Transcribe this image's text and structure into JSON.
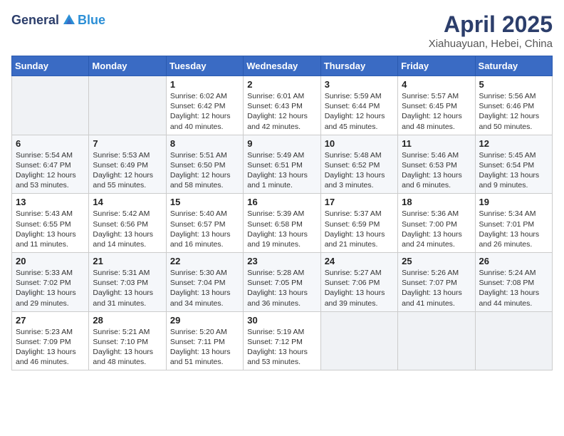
{
  "header": {
    "logo_general": "General",
    "logo_blue": "Blue",
    "title": "April 2025",
    "subtitle": "Xiahuayuan, Hebei, China"
  },
  "weekdays": [
    "Sunday",
    "Monday",
    "Tuesday",
    "Wednesday",
    "Thursday",
    "Friday",
    "Saturday"
  ],
  "weeks": [
    [
      {
        "day": "",
        "empty": true
      },
      {
        "day": "",
        "empty": true
      },
      {
        "day": "1",
        "sunrise": "Sunrise: 6:02 AM",
        "sunset": "Sunset: 6:42 PM",
        "daylight": "Daylight: 12 hours and 40 minutes."
      },
      {
        "day": "2",
        "sunrise": "Sunrise: 6:01 AM",
        "sunset": "Sunset: 6:43 PM",
        "daylight": "Daylight: 12 hours and 42 minutes."
      },
      {
        "day": "3",
        "sunrise": "Sunrise: 5:59 AM",
        "sunset": "Sunset: 6:44 PM",
        "daylight": "Daylight: 12 hours and 45 minutes."
      },
      {
        "day": "4",
        "sunrise": "Sunrise: 5:57 AM",
        "sunset": "Sunset: 6:45 PM",
        "daylight": "Daylight: 12 hours and 48 minutes."
      },
      {
        "day": "5",
        "sunrise": "Sunrise: 5:56 AM",
        "sunset": "Sunset: 6:46 PM",
        "daylight": "Daylight: 12 hours and 50 minutes."
      }
    ],
    [
      {
        "day": "6",
        "sunrise": "Sunrise: 5:54 AM",
        "sunset": "Sunset: 6:47 PM",
        "daylight": "Daylight: 12 hours and 53 minutes."
      },
      {
        "day": "7",
        "sunrise": "Sunrise: 5:53 AM",
        "sunset": "Sunset: 6:49 PM",
        "daylight": "Daylight: 12 hours and 55 minutes."
      },
      {
        "day": "8",
        "sunrise": "Sunrise: 5:51 AM",
        "sunset": "Sunset: 6:50 PM",
        "daylight": "Daylight: 12 hours and 58 minutes."
      },
      {
        "day": "9",
        "sunrise": "Sunrise: 5:49 AM",
        "sunset": "Sunset: 6:51 PM",
        "daylight": "Daylight: 13 hours and 1 minute."
      },
      {
        "day": "10",
        "sunrise": "Sunrise: 5:48 AM",
        "sunset": "Sunset: 6:52 PM",
        "daylight": "Daylight: 13 hours and 3 minutes."
      },
      {
        "day": "11",
        "sunrise": "Sunrise: 5:46 AM",
        "sunset": "Sunset: 6:53 PM",
        "daylight": "Daylight: 13 hours and 6 minutes."
      },
      {
        "day": "12",
        "sunrise": "Sunrise: 5:45 AM",
        "sunset": "Sunset: 6:54 PM",
        "daylight": "Daylight: 13 hours and 9 minutes."
      }
    ],
    [
      {
        "day": "13",
        "sunrise": "Sunrise: 5:43 AM",
        "sunset": "Sunset: 6:55 PM",
        "daylight": "Daylight: 13 hours and 11 minutes."
      },
      {
        "day": "14",
        "sunrise": "Sunrise: 5:42 AM",
        "sunset": "Sunset: 6:56 PM",
        "daylight": "Daylight: 13 hours and 14 minutes."
      },
      {
        "day": "15",
        "sunrise": "Sunrise: 5:40 AM",
        "sunset": "Sunset: 6:57 PM",
        "daylight": "Daylight: 13 hours and 16 minutes."
      },
      {
        "day": "16",
        "sunrise": "Sunrise: 5:39 AM",
        "sunset": "Sunset: 6:58 PM",
        "daylight": "Daylight: 13 hours and 19 minutes."
      },
      {
        "day": "17",
        "sunrise": "Sunrise: 5:37 AM",
        "sunset": "Sunset: 6:59 PM",
        "daylight": "Daylight: 13 hours and 21 minutes."
      },
      {
        "day": "18",
        "sunrise": "Sunrise: 5:36 AM",
        "sunset": "Sunset: 7:00 PM",
        "daylight": "Daylight: 13 hours and 24 minutes."
      },
      {
        "day": "19",
        "sunrise": "Sunrise: 5:34 AM",
        "sunset": "Sunset: 7:01 PM",
        "daylight": "Daylight: 13 hours and 26 minutes."
      }
    ],
    [
      {
        "day": "20",
        "sunrise": "Sunrise: 5:33 AM",
        "sunset": "Sunset: 7:02 PM",
        "daylight": "Daylight: 13 hours and 29 minutes."
      },
      {
        "day": "21",
        "sunrise": "Sunrise: 5:31 AM",
        "sunset": "Sunset: 7:03 PM",
        "daylight": "Daylight: 13 hours and 31 minutes."
      },
      {
        "day": "22",
        "sunrise": "Sunrise: 5:30 AM",
        "sunset": "Sunset: 7:04 PM",
        "daylight": "Daylight: 13 hours and 34 minutes."
      },
      {
        "day": "23",
        "sunrise": "Sunrise: 5:28 AM",
        "sunset": "Sunset: 7:05 PM",
        "daylight": "Daylight: 13 hours and 36 minutes."
      },
      {
        "day": "24",
        "sunrise": "Sunrise: 5:27 AM",
        "sunset": "Sunset: 7:06 PM",
        "daylight": "Daylight: 13 hours and 39 minutes."
      },
      {
        "day": "25",
        "sunrise": "Sunrise: 5:26 AM",
        "sunset": "Sunset: 7:07 PM",
        "daylight": "Daylight: 13 hours and 41 minutes."
      },
      {
        "day": "26",
        "sunrise": "Sunrise: 5:24 AM",
        "sunset": "Sunset: 7:08 PM",
        "daylight": "Daylight: 13 hours and 44 minutes."
      }
    ],
    [
      {
        "day": "27",
        "sunrise": "Sunrise: 5:23 AM",
        "sunset": "Sunset: 7:09 PM",
        "daylight": "Daylight: 13 hours and 46 minutes."
      },
      {
        "day": "28",
        "sunrise": "Sunrise: 5:21 AM",
        "sunset": "Sunset: 7:10 PM",
        "daylight": "Daylight: 13 hours and 48 minutes."
      },
      {
        "day": "29",
        "sunrise": "Sunrise: 5:20 AM",
        "sunset": "Sunset: 7:11 PM",
        "daylight": "Daylight: 13 hours and 51 minutes."
      },
      {
        "day": "30",
        "sunrise": "Sunrise: 5:19 AM",
        "sunset": "Sunset: 7:12 PM",
        "daylight": "Daylight: 13 hours and 53 minutes."
      },
      {
        "day": "",
        "empty": true
      },
      {
        "day": "",
        "empty": true
      },
      {
        "day": "",
        "empty": true
      }
    ]
  ]
}
